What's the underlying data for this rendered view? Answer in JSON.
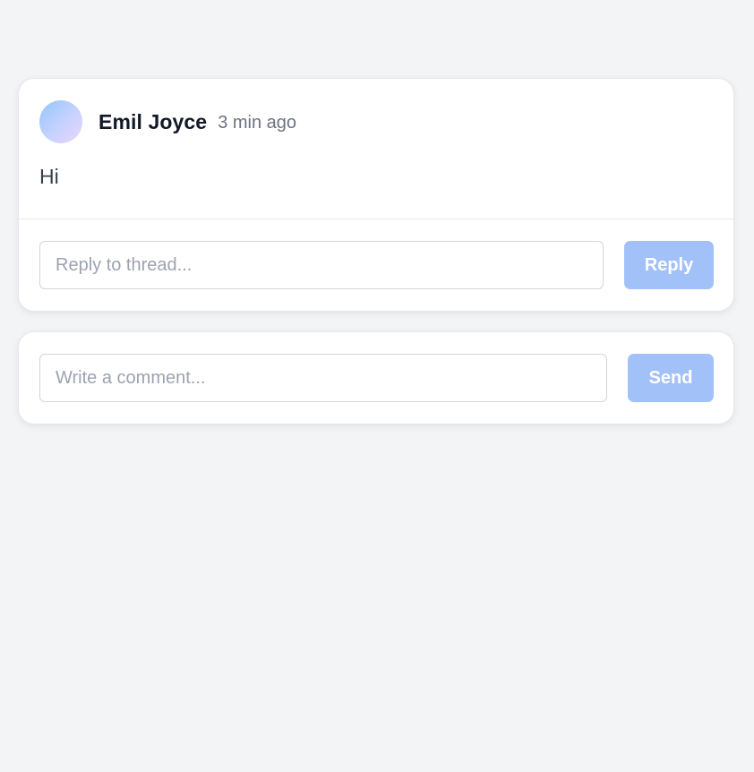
{
  "thread": {
    "author": "Emil Joyce",
    "time": "3 min ago",
    "message": "Hi",
    "reply_placeholder": "Reply to thread...",
    "reply_button": "Reply"
  },
  "composer": {
    "placeholder": "Write a comment...",
    "send_button": "Send"
  },
  "colors": {
    "background": "#f3f4f6",
    "button": "#a2c1f9",
    "card": "#ffffff"
  }
}
